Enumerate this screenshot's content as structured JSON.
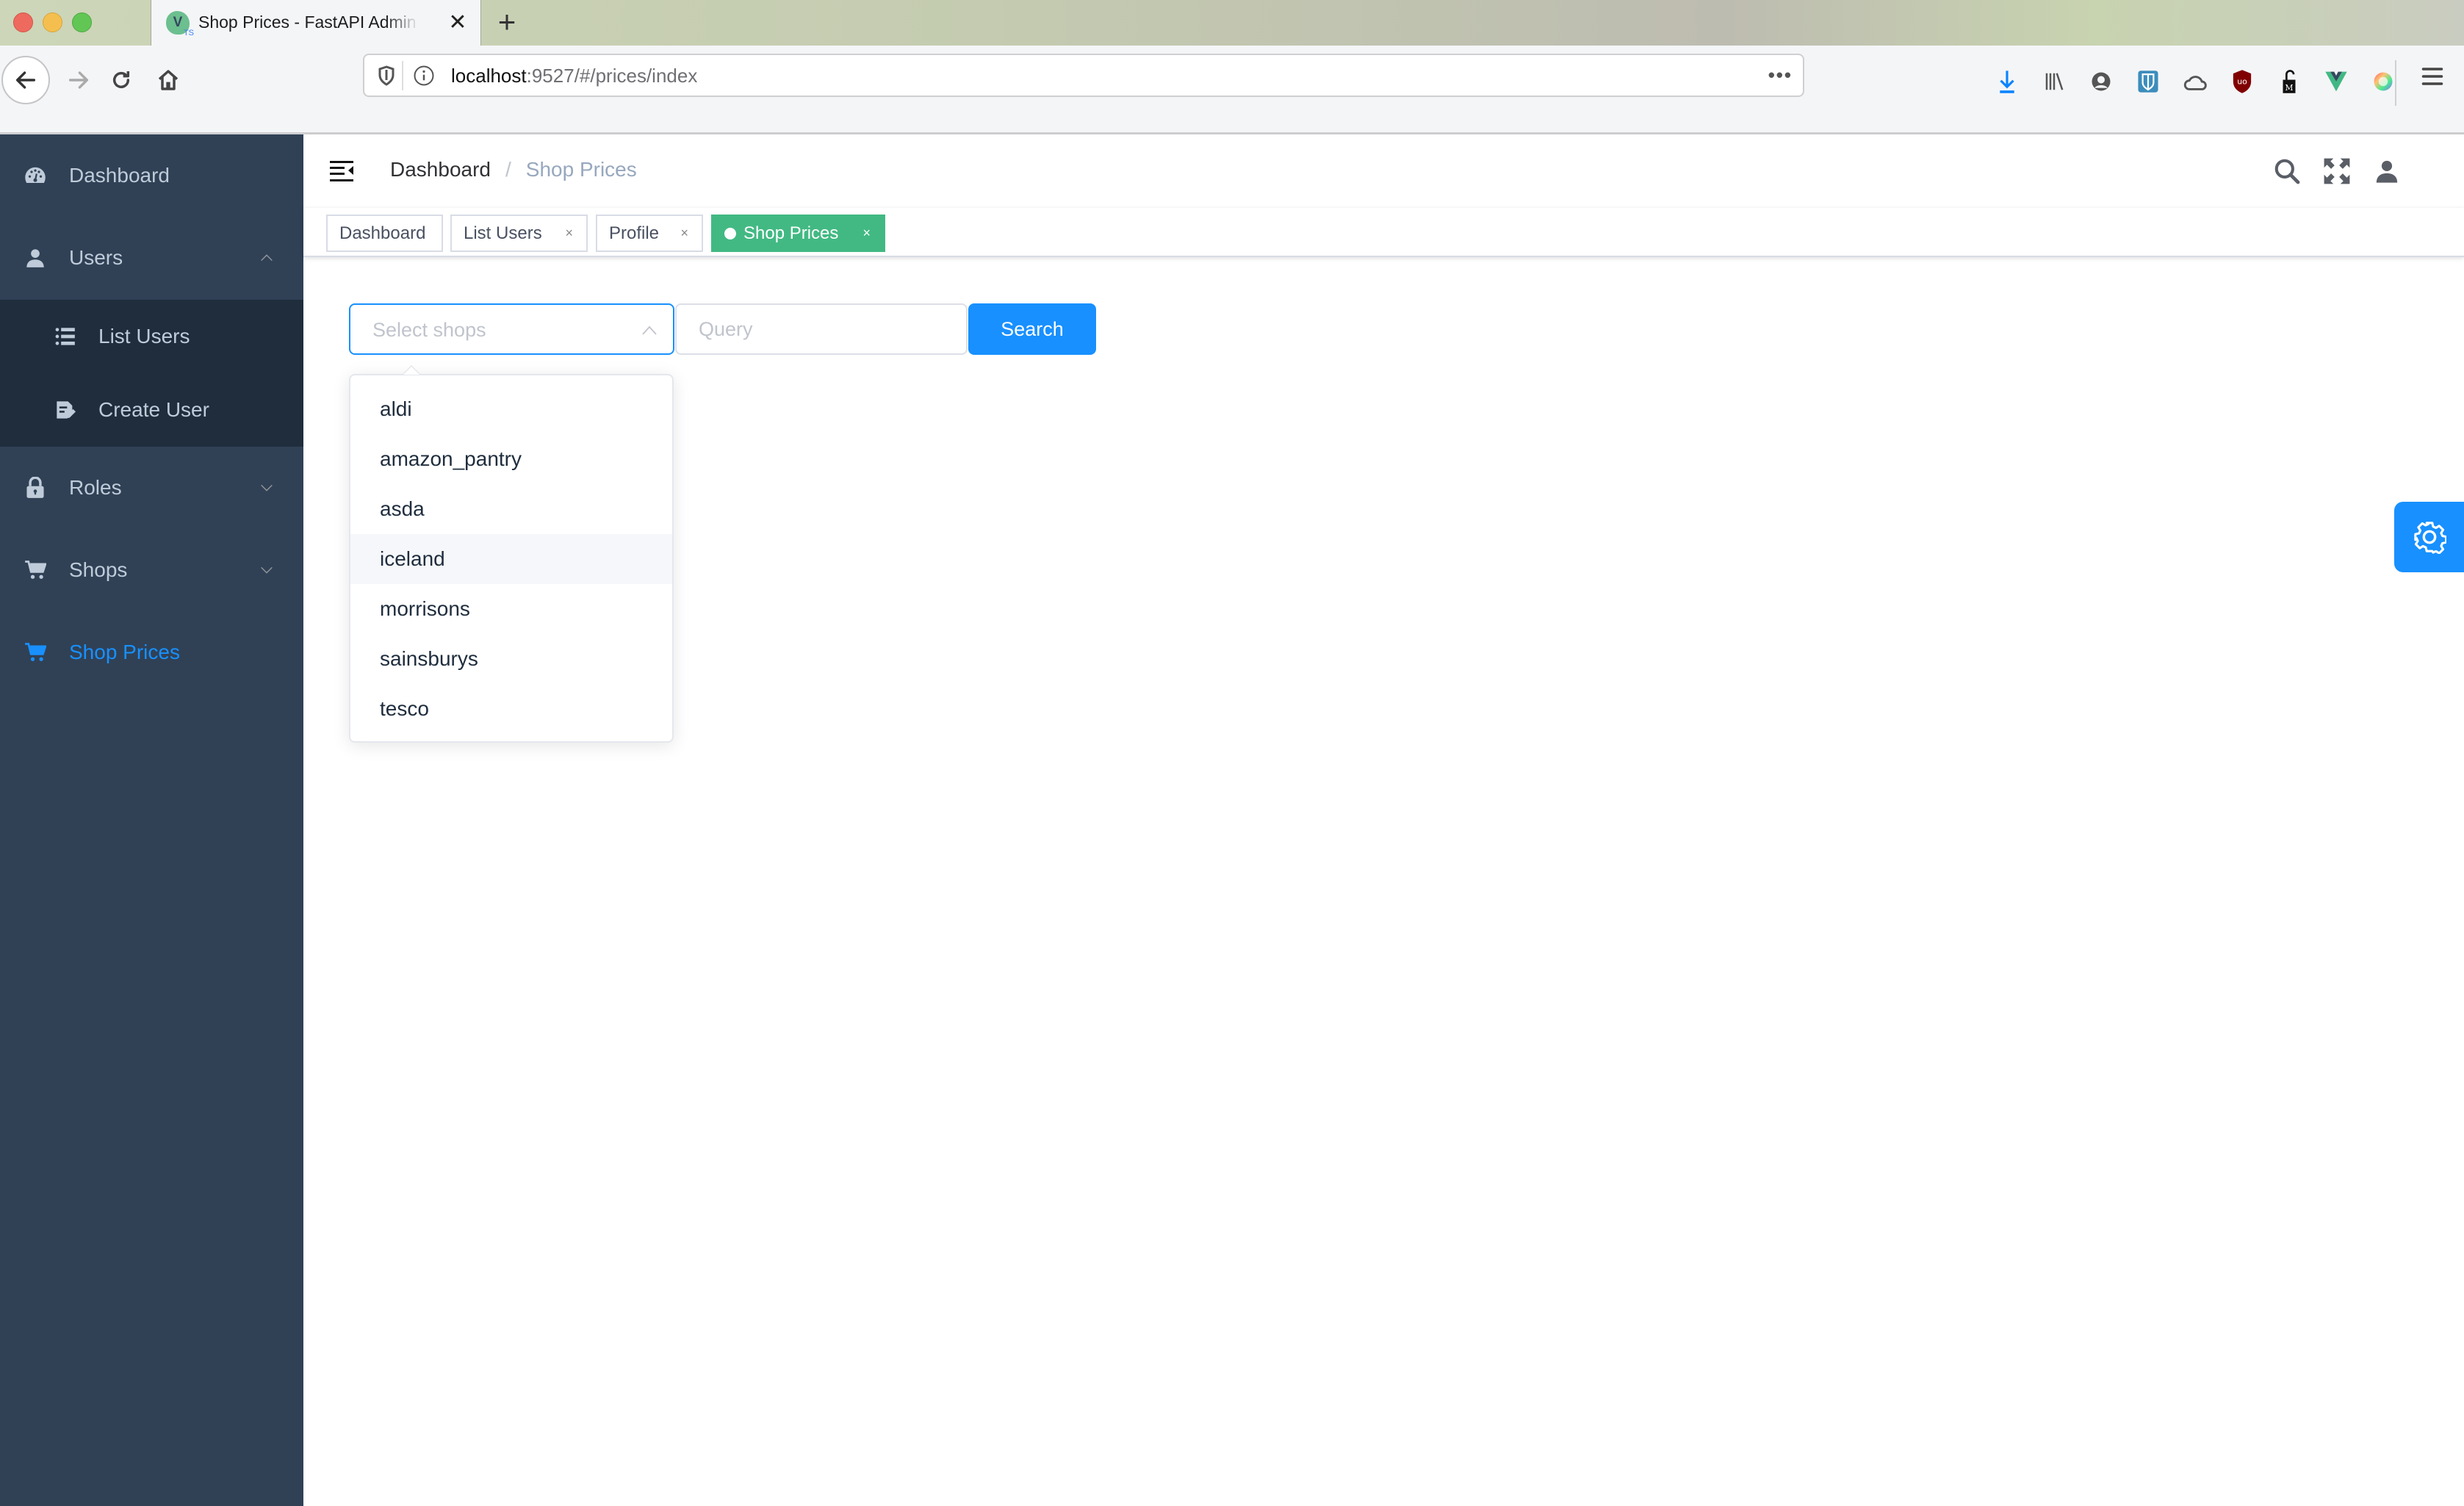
{
  "browser": {
    "tab": {
      "favicon": "V",
      "favicon_sub": "TS",
      "title": "Shop Prices - FastAPI Admin Template",
      "close": "✕"
    },
    "new_tab": "+",
    "url": {
      "host": "localhost",
      "rest": ":9527/#/prices/index",
      "more": "•••"
    },
    "extensions": [
      "download-icon",
      "library-icon",
      "account-icon",
      "bitwarden-icon",
      "cloud-icon",
      "ublock-icon",
      "metamask-lock-icon",
      "vue-devtools-icon",
      "color-picker-icon"
    ]
  },
  "sidebar": {
    "items": [
      {
        "label": "Dashboard",
        "icon": "dashboard-icon"
      },
      {
        "label": "Users",
        "icon": "user-icon",
        "expanded": true,
        "children": [
          {
            "label": "List Users",
            "icon": "list-icon"
          },
          {
            "label": "Create User",
            "icon": "edit-document-icon"
          }
        ]
      },
      {
        "label": "Roles",
        "icon": "lock-icon",
        "expanded": false
      },
      {
        "label": "Shops",
        "icon": "cart-icon",
        "expanded": false
      },
      {
        "label": "Shop Prices",
        "icon": "cart-icon",
        "active": true
      }
    ],
    "colors": {
      "bg": "#304156",
      "submenu_bg": "#1f2d3d",
      "text": "#bfcbd9",
      "active": "#1890ff"
    }
  },
  "navbar": {
    "breadcrumb": [
      "Dashboard",
      "Shop Prices"
    ],
    "separator": "/"
  },
  "tags": [
    {
      "label": "Dashboard",
      "closable": false
    },
    {
      "label": "List Users",
      "closable": true
    },
    {
      "label": "Profile",
      "closable": true
    },
    {
      "label": "Shop Prices",
      "closable": true,
      "active": true
    }
  ],
  "tag_close": "×",
  "filter": {
    "select": {
      "placeholder": "Select shops",
      "open": true
    },
    "query": {
      "placeholder": "Query",
      "value": ""
    },
    "search_label": "Search",
    "options": [
      "aldi",
      "amazon_pantry",
      "asda",
      "iceland",
      "morrisons",
      "sainsburys",
      "tesco"
    ],
    "hovered_option": "iceland"
  },
  "colors": {
    "primary": "#1890ff",
    "tag_active": "#42b983"
  }
}
